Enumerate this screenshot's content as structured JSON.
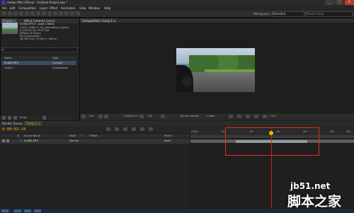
{
  "window": {
    "title": "Adobe After Effects - Untitled Project.aep *",
    "buttons": [
      "_",
      "□",
      "×"
    ]
  },
  "menu": [
    "File",
    "Edit",
    "Composition",
    "Layer",
    "Effect",
    "Animation",
    "View",
    "Window",
    "Help"
  ],
  "toolbar": {
    "workspace_label": "Workspace:",
    "workspace_value": "Standard",
    "search_placeholder": "Search Help"
  },
  "project_panel": {
    "tabs": [
      "Project ×",
      "Effect Controls (none)"
    ],
    "file_name": "01460.MTS ▾ , used 1 times",
    "info_lines": [
      "1440 x 1080 (1.33) (separating (Upper)",
      "Δ 0;00;01;18, 29.97 fps",
      "Millions of Colors",
      "No Compression",
      "48.000 kHz / 32 bit U / Stereo"
    ],
    "search_placeholder": "ρ▾",
    "columns": [
      "Name",
      "Type"
    ],
    "items": [
      {
        "name": "01460.MTS",
        "type": "Footage"
      },
      {
        "name": "Comp 1",
        "type": "Composition"
      }
    ],
    "footer_bpc": "8 bpc"
  },
  "composition_panel": {
    "tab": "Composition: Comp 1 ▾",
    "sub_tab": "Comp 1",
    "viewer_bar": {
      "zoom": "72%",
      "timecode": "0:00:02:14",
      "resolution": "Full",
      "camera": "Active Camera",
      "views": "1 View",
      "exposure": "+0.0"
    }
  },
  "timeline": {
    "tabs": [
      "Render Queue",
      "Comp 1 ×"
    ],
    "current_time": "0:00:02:14",
    "columns": [
      "#",
      "Source Name",
      "Mode",
      "T",
      "TrkMat",
      "Parent"
    ],
    "layer": {
      "index": "1",
      "name": "01460.MTS",
      "mode": "Normal",
      "parent": "None"
    },
    "ruler_ticks": [
      "0:00s",
      "05s",
      "10s",
      "15s",
      "20s",
      "25s",
      "30s"
    ]
  },
  "watermark": {
    "site": "jb51.net",
    "brand": "脚本之家"
  },
  "colors": {
    "timecode": "#ffb400",
    "highlight_box": "#e0341f",
    "playhead": "#d02020"
  }
}
